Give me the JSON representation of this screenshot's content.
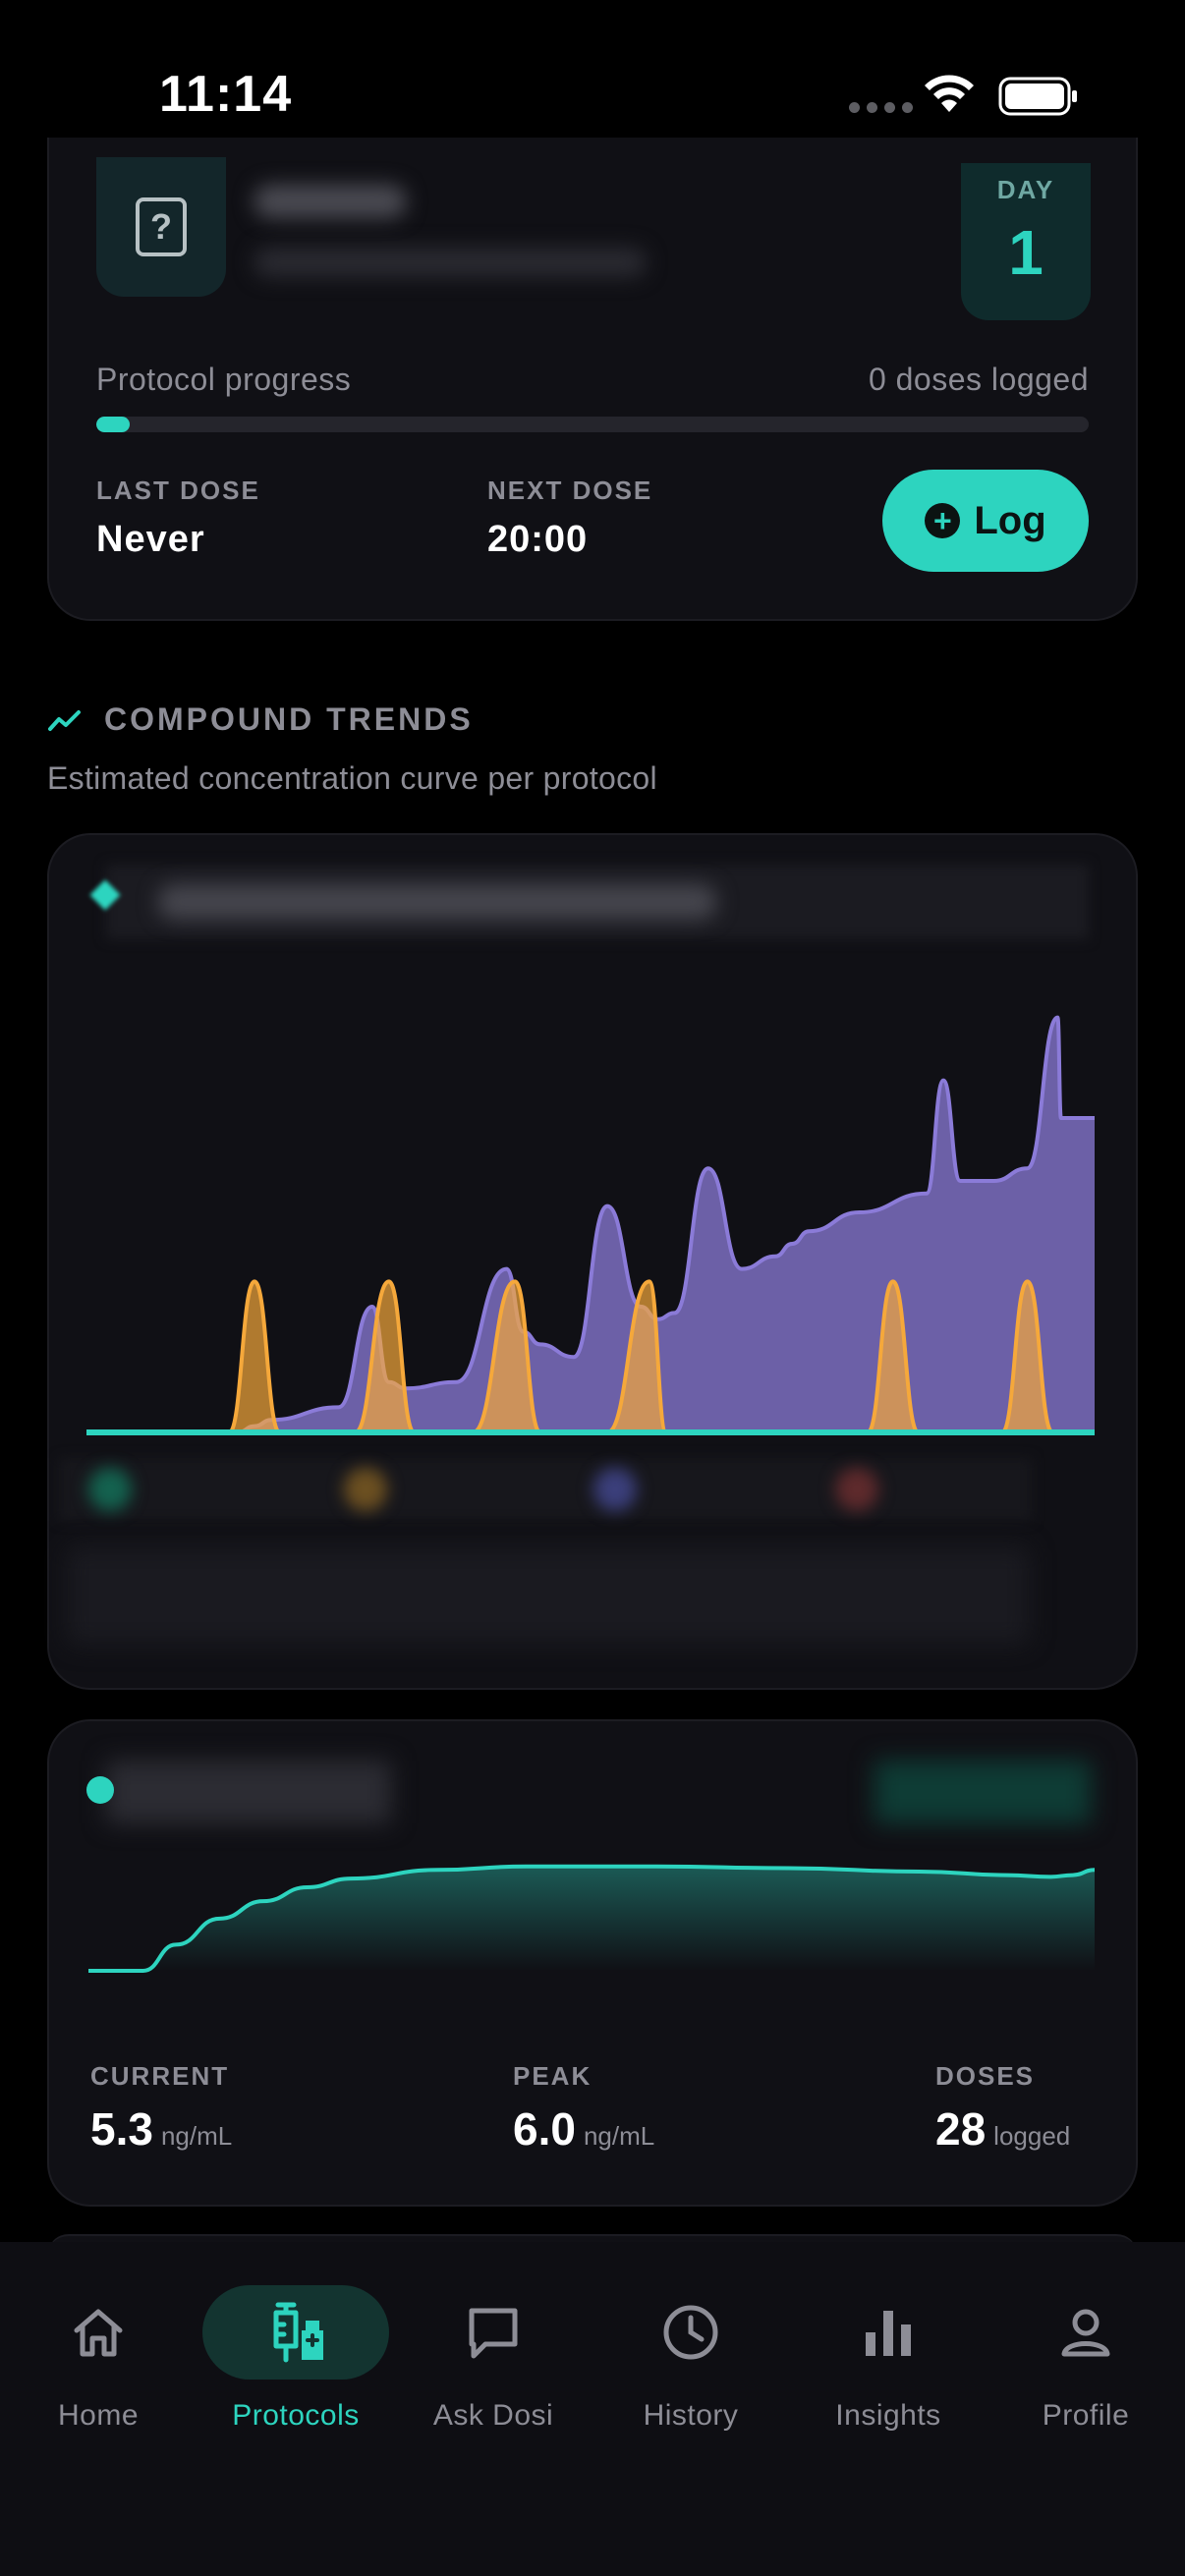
{
  "status_bar": {
    "time": "11:14"
  },
  "protocol_card": {
    "icon": "question-mark-icon",
    "day_label": "DAY",
    "day_number": "1",
    "progress_label": "Protocol progress",
    "doses_logged": "0 doses logged",
    "progress_fraction": 0.03,
    "last_dose_label": "LAST DOSE",
    "last_dose_value": "Never",
    "next_dose_label": "NEXT DOSE",
    "next_dose_value": "20:00",
    "log_button": "Log"
  },
  "section": {
    "title": "COMPOUND TRENDS",
    "subtitle": "Estimated concentration curve per protocol",
    "icon": "trend-line-icon"
  },
  "colors": {
    "accent": "#2dd4bf",
    "purple": "#8b7bd8",
    "orange": "#f5a83b",
    "background": "#000000",
    "card": "#101015"
  },
  "chart_data": [
    {
      "type": "area",
      "series": [
        {
          "color": "#8b7bd8",
          "x": [
            0,
            50,
            90,
            100,
            110,
            150,
            170,
            180,
            190,
            220,
            250,
            260,
            270,
            290,
            310,
            330,
            340,
            350,
            370,
            390,
            410,
            420,
            430,
            460,
            500,
            510,
            520,
            540,
            560,
            578,
            580,
            600
          ],
          "values": [
            0,
            0,
            0,
            0.5,
            1,
            2,
            10,
            4,
            3.5,
            4,
            13,
            8,
            7,
            6,
            18,
            10,
            9,
            9.5,
            21,
            13,
            14,
            15,
            16,
            17.5,
            19,
            28,
            20,
            20,
            21,
            33,
            25,
            25
          ]
        },
        {
          "color": "#f5a83b",
          "x": [
            0,
            85,
            100,
            115,
            160,
            180,
            195,
            230,
            255,
            270,
            310,
            335,
            345,
            390,
            465,
            480,
            495,
            545,
            560,
            575,
            600
          ],
          "values": [
            0,
            0,
            12,
            0,
            0,
            12,
            0,
            0,
            12,
            0,
            0,
            12,
            0,
            0,
            0,
            12,
            0,
            0,
            12,
            0,
            0
          ]
        },
        {
          "color": "#2dd4bf",
          "x": [
            0,
            600
          ],
          "values": [
            0,
            0
          ]
        }
      ],
      "ylim": [
        0,
        35
      ]
    },
    {
      "type": "area",
      "series": [
        {
          "color": "#2dd4bf",
          "x": [
            0,
            10,
            20,
            25,
            40,
            60,
            80,
            100,
            120,
            160,
            200,
            260,
            320,
            380,
            420,
            440,
            450,
            460
          ],
          "values": [
            0,
            0,
            0,
            0,
            1.5,
            3,
            4,
            4.8,
            5.3,
            5.8,
            6.0,
            6.0,
            5.9,
            5.7,
            5.5,
            5.4,
            5.5,
            5.8
          ]
        }
      ],
      "ylim": [
        0,
        7
      ]
    }
  ],
  "stats": {
    "current_label": "CURRENT",
    "current_value": "5.3",
    "current_unit": "ng/mL",
    "peak_label": "PEAK",
    "peak_value": "6.0",
    "peak_unit": "ng/mL",
    "doses_label": "DOSES",
    "doses_value": "28",
    "doses_unit": "logged"
  },
  "tabs": [
    {
      "label": "Home",
      "icon": "home-icon",
      "active": false
    },
    {
      "label": "Protocols",
      "icon": "syringe-vials-icon",
      "active": true
    },
    {
      "label": "Ask Dosi",
      "icon": "chat-bubble-icon",
      "active": false
    },
    {
      "label": "History",
      "icon": "clock-icon",
      "active": false
    },
    {
      "label": "Insights",
      "icon": "bar-chart-icon",
      "active": false
    },
    {
      "label": "Profile",
      "icon": "person-icon",
      "active": false
    }
  ]
}
